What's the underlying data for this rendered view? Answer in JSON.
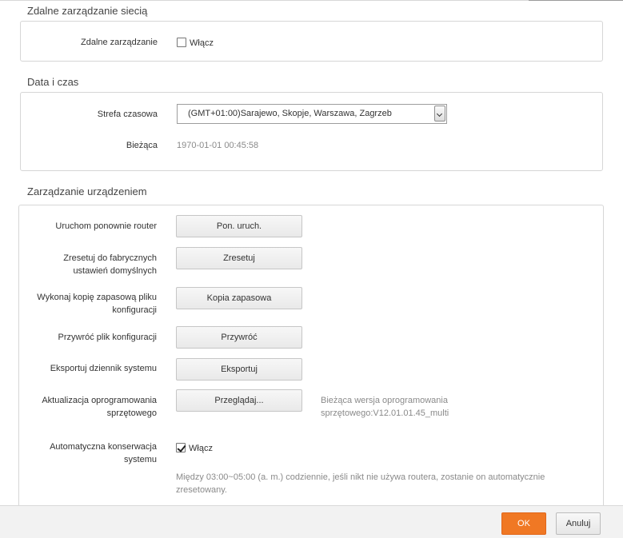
{
  "remote": {
    "section_title": "Zdalne zarządzanie siecią",
    "label": "Zdalne zarządzanie",
    "enable_label": "Włącz",
    "enabled": false
  },
  "datetime": {
    "section_title": "Data i czas",
    "timezone_label": "Strefa czasowa",
    "timezone_value": "(GMT+01:00)Sarajewo, Skopje, Warszawa, Zagrzeb",
    "current_label": "Bieżąca",
    "current_value": "1970-01-01 00:45:58"
  },
  "device": {
    "section_title": "Zarządzanie urządzeniem",
    "reboot_label": "Uruchom ponownie router",
    "reboot_button": "Pon. uruch.",
    "reset_label_line1": "Zresetuj do fabrycznych",
    "reset_label_line2": "ustawień domyślnych",
    "reset_button": "Zresetuj",
    "backup_label_line1": "Wykonaj kopię zapasową pliku",
    "backup_label_line2": "konfiguracji",
    "backup_button": "Kopia zapasowa",
    "restore_label": "Przywróć plik konfiguracji",
    "restore_button": "Przywróć",
    "export_label": "Eksportuj dziennik systemu",
    "export_button": "Eksportuj",
    "firmware_label_line1": "Aktualizacja oprogramowania",
    "firmware_label_line2": "sprzętowego",
    "firmware_button": "Przeglądaj...",
    "firmware_version_line1": "Bieżąca wersja oprogramowania",
    "firmware_version_line2": "sprzętowego:V12.01.01.45_multi",
    "auto_label_line1": "Automatyczna konserwacja",
    "auto_label_line2": "systemu",
    "auto_enable_label": "Włącz",
    "auto_enabled": true,
    "auto_note_line1": "Między 03:00~05:00 (a. m.) codziennie, jeśli nikt nie używa routera, zostanie on automatycznie",
    "auto_note_line2": "zresetowany."
  },
  "footer": {
    "ok_label": "OK",
    "cancel_label": "Anuluj"
  },
  "colors": {
    "accent": "#f07824"
  }
}
